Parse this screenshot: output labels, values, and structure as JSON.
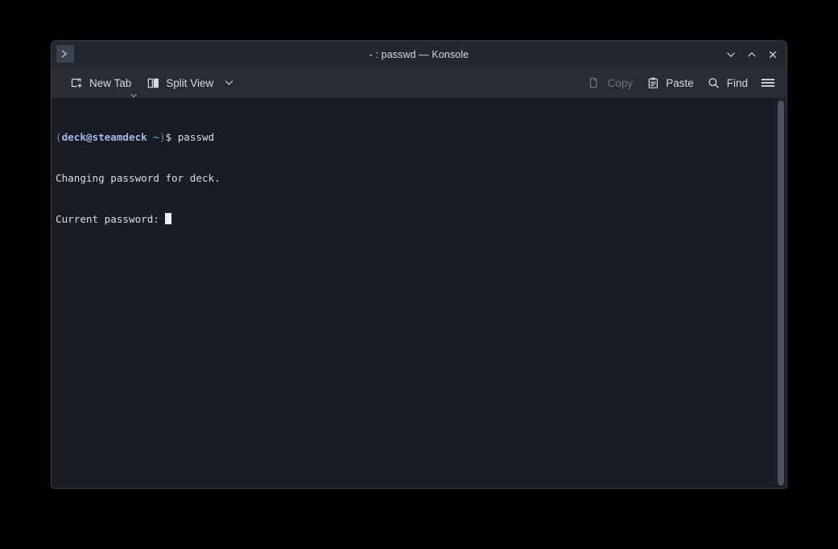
{
  "window": {
    "title": "- : passwd — Konsole",
    "tab_icon": "terminal-prompt-icon",
    "controls": {
      "minimize": "minimize-icon",
      "maximize": "maximize-icon",
      "close": "close-icon"
    }
  },
  "toolbar": {
    "new_tab_label": "New Tab",
    "new_tab_icon": "new-tab-icon",
    "split_view_label": "Split View",
    "split_view_icon": "split-view-icon",
    "copy_label": "Copy",
    "copy_icon": "copy-icon",
    "copy_enabled": false,
    "paste_label": "Paste",
    "paste_icon": "paste-icon",
    "find_label": "Find",
    "find_icon": "search-icon",
    "menu_icon": "hamburger-menu-icon"
  },
  "terminal": {
    "prompt": {
      "open_paren": "(",
      "user_host": "deck@steamdeck",
      "space": " ",
      "path": "~",
      "close_paren": ")",
      "sigil": "$",
      "command": " passwd"
    },
    "lines": [
      "Changing password for deck.",
      "Current password: "
    ]
  },
  "colors": {
    "terminal_bg": "#181c25",
    "toolbar_bg": "#282c34",
    "titlebar_bg": "#232730",
    "foreground": "#d8dee9",
    "user_host": "#a7b8e8",
    "paren": "#7c87a3",
    "tilde": "#4fc3d9",
    "cursor": "#eceff4",
    "disabled_text": "#6e7582",
    "scrollbar_thumb": "#4b515d"
  }
}
